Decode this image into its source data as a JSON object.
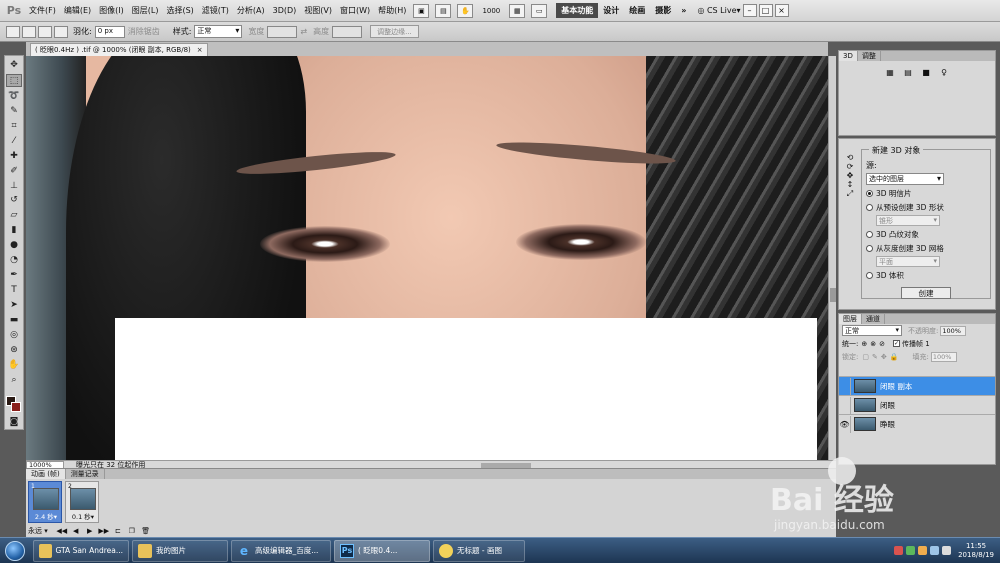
{
  "app": {
    "logo": "Ps"
  },
  "menu": [
    "文件(F)",
    "编辑(E)",
    "图像(I)",
    "图层(L)",
    "选择(S)",
    "滤镜(T)",
    "分析(A)",
    "3D(D)",
    "视图(V)",
    "窗口(W)",
    "帮助(H)"
  ],
  "menubar": {
    "zoom": "1000",
    "workspaces": {
      "active": "基本功能",
      "items": [
        "设计",
        "绘画",
        "摄影"
      ],
      "more": "»"
    },
    "cslive": "CS Live▾",
    "window_buttons": [
      "–",
      "□",
      "×"
    ]
  },
  "options": {
    "feather_label": "羽化:",
    "feather_value": "0 px",
    "antialias_label": "消除锯齿",
    "style_label": "样式:",
    "style_value": "正常",
    "width_label": "宽度",
    "height_label": "高度",
    "refine_label": "调整边缘..."
  },
  "document": {
    "tab_label": "( 眨眼0.4Hz ) .tif @ 1000% (闭眼 副本, RGB/8)",
    "close": "×"
  },
  "status": {
    "zoom": "1000%",
    "info": "曝光只在 32 位起作用"
  },
  "animation": {
    "tabs": [
      "动画 (帧)",
      "测量记录"
    ],
    "frames": [
      {
        "num": "1",
        "delay": "2.4 秒▾",
        "selected": true
      },
      {
        "num": "2",
        "delay": "0.1 秒▾",
        "selected": false
      }
    ],
    "loop": "永远 ▾",
    "controls": [
      "◀◀",
      "◀",
      "▶",
      "▶▶",
      "⊏",
      "❐",
      "🗑"
    ]
  },
  "panel3d": {
    "tabs": [
      "3D",
      "调整"
    ]
  },
  "new3d": {
    "title": "新建 3D 对象",
    "source_label": "源:",
    "source_value": "选中的图层",
    "options": [
      {
        "label": "3D 明信片",
        "checked": true
      },
      {
        "label": "从预设创建 3D 形状",
        "checked": false
      },
      {
        "label": "3D 凸纹对象",
        "checked": false
      },
      {
        "label": "从灰度创建 3D 网格",
        "checked": false
      },
      {
        "label": "3D 体积",
        "checked": false
      }
    ],
    "shape_value": "锥形",
    "mesh_value": "平面",
    "create_label": "创建"
  },
  "layers": {
    "tabs": [
      "图层",
      "通道"
    ],
    "blend_mode": "正常",
    "opacity_label": "不透明度:",
    "opacity_value": "100%",
    "unify_label": "统一:",
    "propagate_label": "传播帧 1",
    "lock_label": "锁定:",
    "fill_label": "填充:",
    "fill_value": "100%",
    "items": [
      {
        "name": "闭眼 副本",
        "visible": false,
        "selected": true
      },
      {
        "name": "闭眼",
        "visible": false,
        "selected": false
      },
      {
        "name": "睁眼",
        "visible": true,
        "selected": false
      }
    ]
  },
  "watermark": {
    "text": "Bai 经验",
    "url": "jingyan.baidu.com"
  },
  "taskbar": {
    "items": [
      "GTA San Andrea...",
      "我的图片",
      "高级编辑器_百度...",
      "( 眨眼0.4...",
      "无标题 - 画图"
    ],
    "time": "11:55",
    "date": "2018/8/19"
  }
}
